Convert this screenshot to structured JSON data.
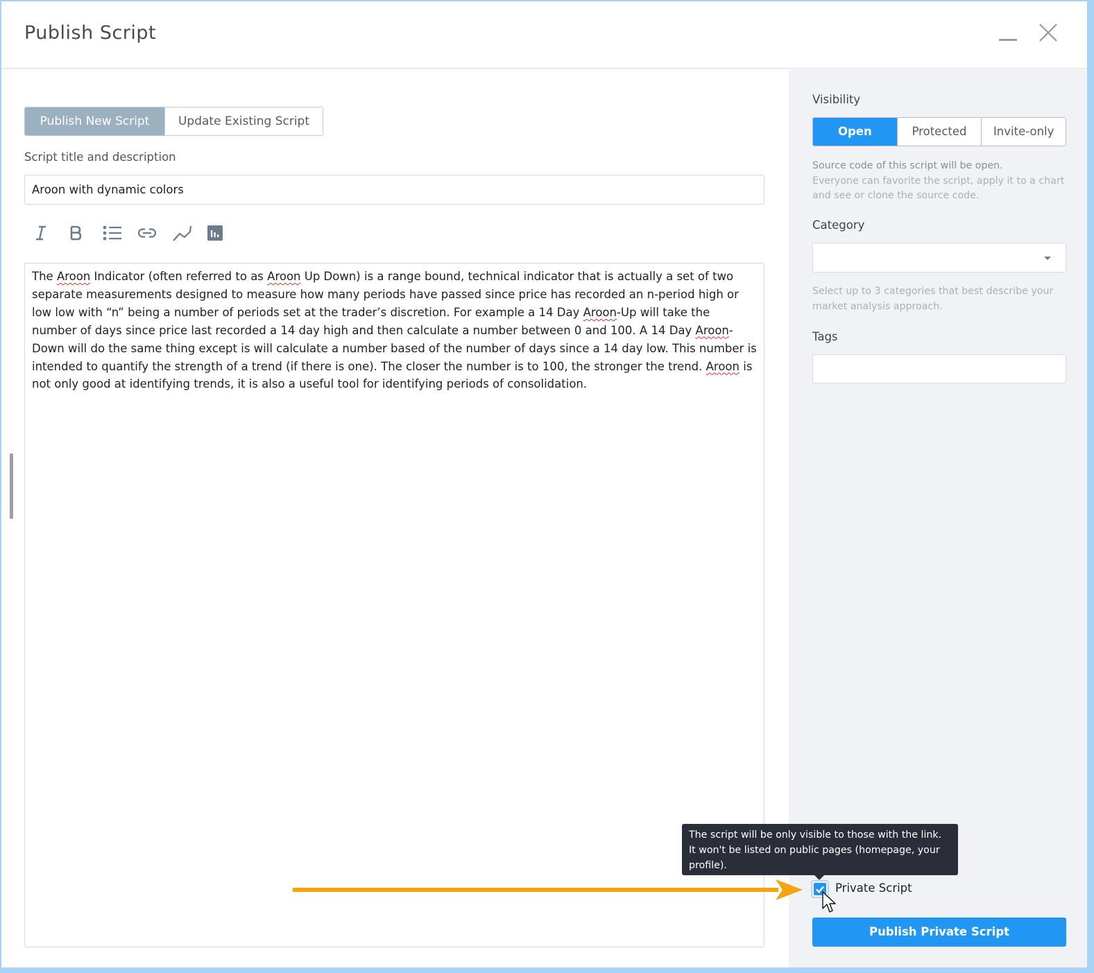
{
  "window": {
    "title": "Publish Script",
    "minimize_icon": "minimize-icon",
    "close_icon": "close-icon"
  },
  "mode_tabs": [
    {
      "label": "Publish New Script",
      "active": true
    },
    {
      "label": "Update Existing Script",
      "active": false
    }
  ],
  "form": {
    "title_label": "Script title and description",
    "title_value": "Aroon with dynamic colors",
    "toolbar": [
      {
        "name": "italic",
        "icon": "italic-icon"
      },
      {
        "name": "bold",
        "icon": "bold-icon"
      },
      {
        "name": "bulleted-list",
        "icon": "list-icon"
      },
      {
        "name": "link",
        "icon": "link-icon"
      },
      {
        "name": "insert-chart-line",
        "icon": "line-chart-icon"
      },
      {
        "name": "insert-chart",
        "icon": "bar-chart-icon"
      }
    ],
    "description": {
      "segments": [
        {
          "text": "The ",
          "misspelled": false
        },
        {
          "text": "Aroon",
          "misspelled": true
        },
        {
          "text": " Indicator (often referred to as ",
          "misspelled": false
        },
        {
          "text": "Aroon",
          "misspelled": true
        },
        {
          "text": " Up Down) is a range bound, technical indicator that is actually a set of two separate measurements designed to measure how many periods have passed since price has recorded an n-period high or low low with “n” being a number of periods set at the trader’s discretion. For example a 14 Day ",
          "misspelled": false
        },
        {
          "text": "Aroon",
          "misspelled": true
        },
        {
          "text": "-Up will take the number of days since price last recorded a 14 day high and then calculate a number between 0 and 100. A 14 Day ",
          "misspelled": false
        },
        {
          "text": "Aroon",
          "misspelled": true
        },
        {
          "text": "-Down will do the same thing except is will calculate a number based of the number of days since a 14 day low. This number is intended to quantify the strength of a trend (if there is one). The closer the number is to 100, the stronger the trend. ",
          "misspelled": false
        },
        {
          "text": "Aroon",
          "misspelled": true
        },
        {
          "text": " is not only good at identifying trends, it is also a useful tool for identifying periods of consolidation.",
          "misspelled": false
        }
      ]
    }
  },
  "side": {
    "visibility_label": "Visibility",
    "visibility_options": [
      {
        "label": "Open",
        "active": true
      },
      {
        "label": "Protected",
        "active": false
      },
      {
        "label": "Invite-only",
        "active": false
      }
    ],
    "visibility_desc_strong": "Source code of this script will be open.",
    "visibility_desc": "Everyone can favorite the script, apply it to a chart and see or clone the source code.",
    "category_label": "Category",
    "category_value": "",
    "category_hint": "Select up to 3 categories that best describe your market analysis approach.",
    "tags_label": "Tags",
    "tags_value": "",
    "private_tooltip": "The script will be only visible to those with the link. It won't be listed on public pages (homepage, your profile).",
    "private_checkbox_label": "Private Script",
    "private_checked": true,
    "publish_button": "Publish Private Script"
  },
  "annotation": {
    "arrow_color": "#f5a30f"
  },
  "colors": {
    "accent": "#2196f3",
    "tab_active": "#9bb1bf",
    "tooltip_bg": "#2a2e39",
    "side_bg": "#f0f2f6"
  }
}
